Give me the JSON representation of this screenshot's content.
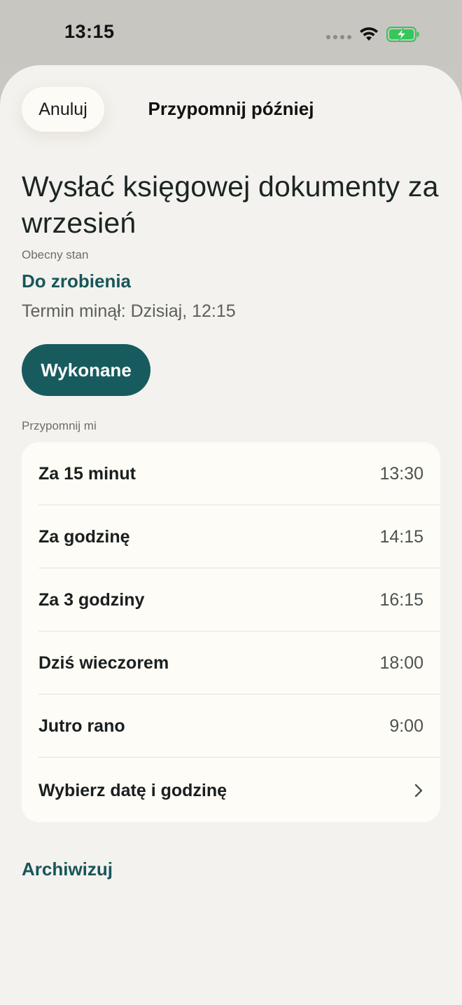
{
  "status_bar": {
    "time": "13:15"
  },
  "header": {
    "cancel_label": "Anuluj",
    "title": "Przypomnij później"
  },
  "task": {
    "title": "Wysłać księgowej dokumenty za wrzesień",
    "state_label": "Obecny stan",
    "state_value": "Do zrobienia",
    "deadline": "Termin minął: Dzisiaj, 12:15"
  },
  "done_button": {
    "label": "Wykonane"
  },
  "remind": {
    "section_label": "Przypomnij mi",
    "options": [
      {
        "label": "Za 15 minut",
        "time": "13:30"
      },
      {
        "label": "Za godzinę",
        "time": "14:15"
      },
      {
        "label": "Za 3 godziny",
        "time": "16:15"
      },
      {
        "label": "Dziś wieczorem",
        "time": "18:00"
      },
      {
        "label": "Jutro rano",
        "time": "9:00"
      },
      {
        "label": "Wybierz datę i godzinę",
        "icon": "chevron-right-icon"
      }
    ]
  },
  "archive": {
    "label": "Archiwizuj"
  },
  "colors": {
    "accent": "#175b5f",
    "accent_text": "#17565a",
    "sheet_bg": "#f4f2ee",
    "card_bg": "#fdfcf7",
    "battery_green": "#35c759"
  }
}
